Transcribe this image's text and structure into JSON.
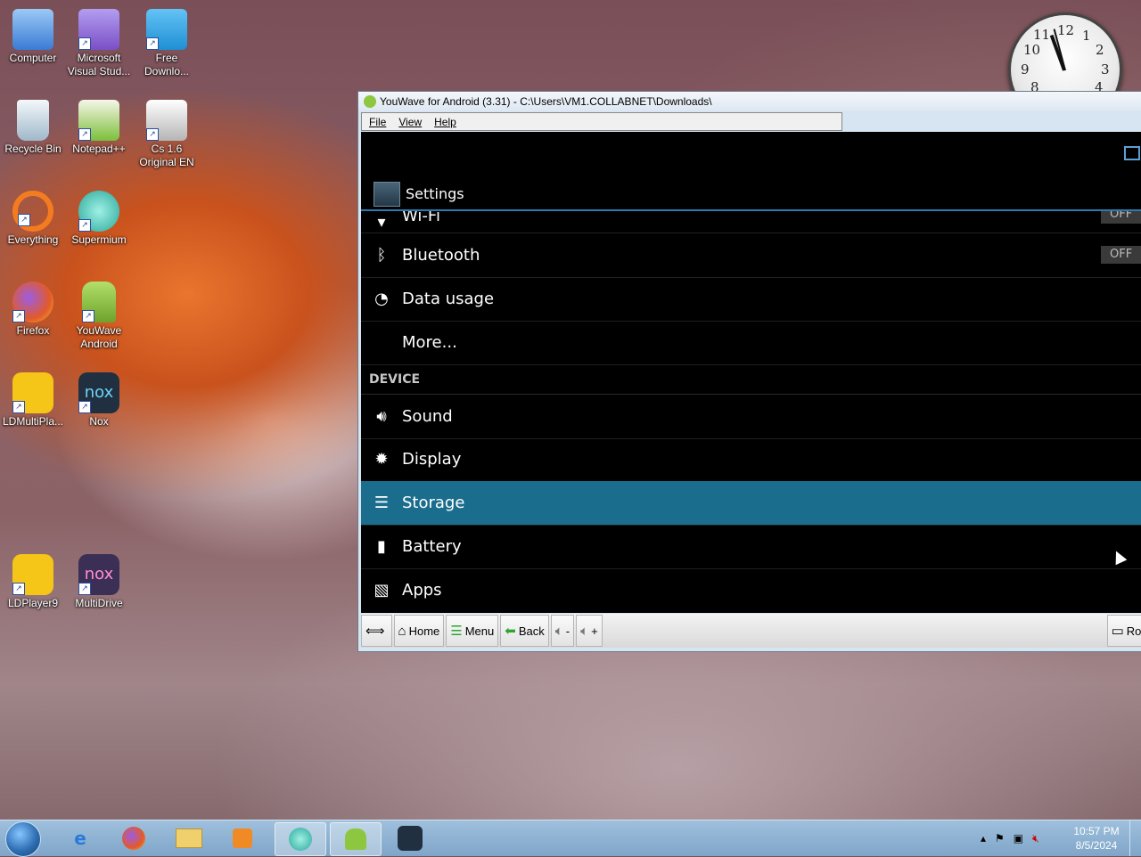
{
  "desktop": {
    "icons": [
      {
        "label": "Computer",
        "color": "#3a7bd5"
      },
      {
        "label": "Microsoft Visual Stud...",
        "color": "#7b4fc7"
      },
      {
        "label": "Free Downlo...",
        "color": "#1f8fd4"
      },
      {
        "label": "Recycle Bin",
        "color": "#cfe3f0"
      },
      {
        "label": "Notepad++",
        "color": "#7bbf3a"
      },
      {
        "label": "Cs 1.6 Original EN",
        "color": "#d9d9d9"
      },
      {
        "label": "Everything",
        "color": "#f47c20"
      },
      {
        "label": "Supermium",
        "color": "#2aa89a"
      },
      {
        "label": "Firefox",
        "color": "#e25a2a"
      },
      {
        "label": "YouWave Android",
        "color": "#8dc63f"
      },
      {
        "label": "LDMultiPla...",
        "color": "#f5c518"
      },
      {
        "label": "Nox",
        "color": "#203040"
      },
      {
        "label": "LDPlayer9",
        "color": "#f5c518"
      },
      {
        "label": "MultiDrive",
        "color": "#3b2f56"
      }
    ]
  },
  "clock_gadget": {
    "n12": "12",
    "n1": "1",
    "n2": "2",
    "n3": "3",
    "n4": "4",
    "n8": "8",
    "n9": "9",
    "n10": "10",
    "n11": "11"
  },
  "window": {
    "title": "YouWave for Android (3.31) - C:\\Users\\VM1.COLLABNET\\Downloads\\",
    "menu": {
      "file": "File",
      "view": "View",
      "help": "Help"
    },
    "settings_title": "Settings",
    "rows": {
      "wifi": "Wi-Fi",
      "wifi_toggle": "OFF",
      "bluetooth": "Bluetooth",
      "bluetooth_toggle": "OFF",
      "data_usage": "Data usage",
      "more": "More...",
      "section_device": "DEVICE",
      "sound": "Sound",
      "display": "Display",
      "storage": "Storage",
      "battery": "Battery",
      "apps": "Apps"
    },
    "toolbar": {
      "home": "Home",
      "menu": "Menu",
      "back": "Back",
      "vol_down": "-",
      "vol_up": "+",
      "rotate": "Rot"
    }
  },
  "taskbar": {
    "time": "10:57 PM",
    "date": "8/5/2024"
  },
  "colors": {
    "selected_row": "#1b6d8d",
    "accent_line": "#2b7bb0"
  }
}
